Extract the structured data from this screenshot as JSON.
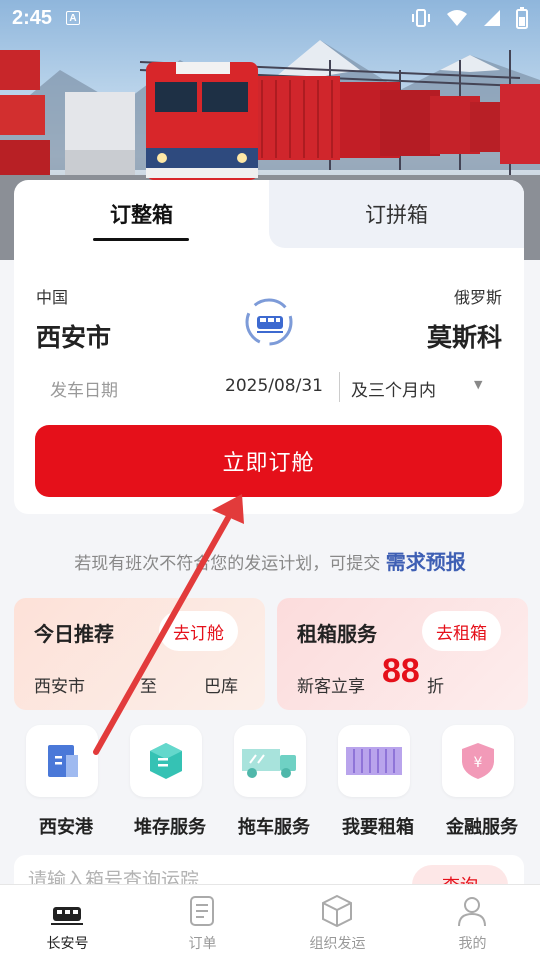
{
  "status_bar": {
    "time": "2:45",
    "indicator": "A"
  },
  "booking": {
    "tabs": [
      {
        "label": "订整箱",
        "active": true
      },
      {
        "label": "订拼箱",
        "active": false
      }
    ],
    "from_country": "中国",
    "from_city": "西安市",
    "to_country": "俄罗斯",
    "to_city": "莫斯科",
    "date_label": "发车日期",
    "date_value": "2025/08/31",
    "date_range": "及三个月内",
    "book_button": "立即订舱"
  },
  "hint": {
    "text": "若现有班次不符合您的发运计划，可提交 ",
    "link": "需求预报"
  },
  "promos": {
    "today": {
      "title": "今日推荐",
      "button": "去订舱",
      "from": "西安市",
      "sep": "至",
      "to": "巴库"
    },
    "rent": {
      "title": "租箱服务",
      "button": "去租箱",
      "prefix": "新客立享",
      "discount": "88",
      "suffix": "折"
    }
  },
  "services": [
    {
      "label": "西安港",
      "icon": "building-icon"
    },
    {
      "label": "堆存服务",
      "icon": "stack-icon"
    },
    {
      "label": "拖车服务",
      "icon": "truck-icon"
    },
    {
      "label": "我要租箱",
      "icon": "container-icon"
    },
    {
      "label": "金融服务",
      "icon": "yuan-shield-icon"
    }
  ],
  "search": {
    "placeholder": "请输入箱号查询运踪",
    "button": "查询"
  },
  "nav": [
    {
      "label": "长安号",
      "icon": "train-icon",
      "active": true
    },
    {
      "label": "订单",
      "icon": "order-icon",
      "active": false
    },
    {
      "label": "组织发运",
      "icon": "cube-icon",
      "active": false
    },
    {
      "label": "我的",
      "icon": "user-icon",
      "active": false
    }
  ],
  "colors": {
    "primary_red": "#e5101a",
    "link_blue": "#3e5fb4",
    "background": "#f4f5f8"
  },
  "train_lettering": "长安号"
}
